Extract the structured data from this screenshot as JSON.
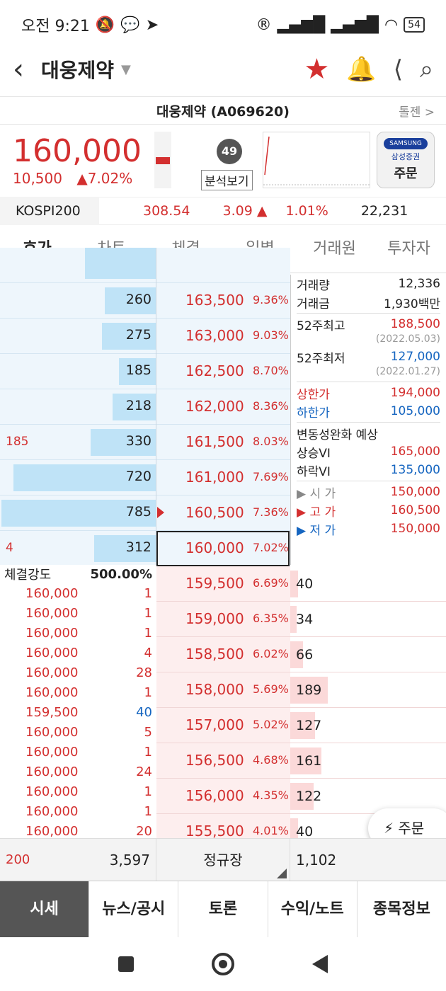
{
  "status": {
    "time": "오전 9:21",
    "battery": "54"
  },
  "header": {
    "title": "대웅제약"
  },
  "codebar": {
    "title": "대웅제약 (A069620)",
    "toggle": "톨젠 >"
  },
  "price": {
    "current": "160,000",
    "change": "10,500",
    "change_pct": "▲7.02%",
    "score": "49",
    "analysis": "분석보기"
  },
  "broker": {
    "logo": "SAMSUNG",
    "name": "삼성증권",
    "order": "주문"
  },
  "index": {
    "name": "KOSPI200",
    "value": "308.54",
    "change": "3.09 ▲",
    "pct": "1.01%",
    "volume": "22,231"
  },
  "tabs": [
    "호가",
    "차트",
    "체결",
    "일별",
    "거래원",
    "투자자"
  ],
  "asks": [
    {
      "qty": "260",
      "price": "163,500",
      "pct": "9.36%",
      "bar": 0.33,
      "left": ""
    },
    {
      "qty": "275",
      "price": "163,000",
      "pct": "9.03%",
      "bar": 0.35,
      "left": ""
    },
    {
      "qty": "185",
      "price": "162,500",
      "pct": "8.70%",
      "bar": 0.24,
      "left": ""
    },
    {
      "qty": "218",
      "price": "162,000",
      "pct": "8.36%",
      "bar": 0.28,
      "left": ""
    },
    {
      "qty": "330",
      "price": "161,500",
      "pct": "8.03%",
      "bar": 0.42,
      "left": "185"
    },
    {
      "qty": "720",
      "price": "161,000",
      "pct": "7.69%",
      "bar": 0.92,
      "left": ""
    },
    {
      "qty": "785",
      "price": "160,500",
      "pct": "7.36%",
      "bar": 1.0,
      "left": ""
    },
    {
      "qty": "312",
      "price": "160,000",
      "pct": "7.02%",
      "bar": 0.4,
      "left": "4"
    }
  ],
  "bids": [
    {
      "qty": "40",
      "price": "159,500",
      "pct": "6.69%",
      "bar": 0.05
    },
    {
      "qty": "34",
      "price": "159,000",
      "pct": "6.35%",
      "bar": 0.04
    },
    {
      "qty": "66",
      "price": "158,500",
      "pct": "6.02%",
      "bar": 0.08
    },
    {
      "qty": "189",
      "price": "158,000",
      "pct": "5.69%",
      "bar": 0.24
    },
    {
      "qty": "127",
      "price": "157,000",
      "pct": "5.02%",
      "bar": 0.16
    },
    {
      "qty": "161",
      "price": "156,500",
      "pct": "4.68%",
      "bar": 0.2
    },
    {
      "qty": "122",
      "price": "156,000",
      "pct": "4.35%",
      "bar": 0.15
    },
    {
      "qty": "40",
      "price": "155,500",
      "pct": "4.01%",
      "bar": 0.05
    }
  ],
  "info": {
    "vol_label": "거래량",
    "vol": "12,336",
    "amt_label": "거래금",
    "amt": "1,930백만",
    "hi52_label": "52주최고",
    "hi52": "188,500",
    "hi52_date": "(2022.05.03)",
    "lo52_label": "52주최저",
    "lo52": "127,000",
    "lo52_date": "(2022.01.27)",
    "upper_label": "상한가",
    "upper": "194,000",
    "lower_label": "하한가",
    "lower": "105,000",
    "vi_label": "변동성완화 예상",
    "vi_up_label": "상승VI",
    "vi_up": "165,000",
    "vi_down_label": "하락VI",
    "vi_down": "135,000",
    "open_label": "▶ 시 가",
    "open": "150,000",
    "high_label": "▶ 고 가",
    "high": "160,500",
    "low_label": "▶ 저 가",
    "low": "150,000"
  },
  "trades": {
    "strength_label": "체결강도",
    "strength": "500.00%",
    "rows": [
      {
        "p": "160,000",
        "q": "1"
      },
      {
        "p": "160,000",
        "q": "1"
      },
      {
        "p": "160,000",
        "q": "1"
      },
      {
        "p": "160,000",
        "q": "4"
      },
      {
        "p": "160,000",
        "q": "28"
      },
      {
        "p": "160,000",
        "q": "1"
      },
      {
        "p": "159,500",
        "q": "40"
      },
      {
        "p": "160,000",
        "q": "5"
      },
      {
        "p": "160,000",
        "q": "1"
      },
      {
        "p": "160,000",
        "q": "24"
      },
      {
        "p": "160,000",
        "q": "1"
      },
      {
        "p": "160,000",
        "q": "1"
      },
      {
        "p": "160,000",
        "q": "20"
      }
    ]
  },
  "fab": {
    "label": "⚡ 주문"
  },
  "summary": {
    "a": "200",
    "b": "3,597",
    "session": "정규장",
    "c": "1,102"
  },
  "bottom_tabs": [
    "시세",
    "뉴스/공시",
    "토론",
    "수익/노트",
    "종목정보"
  ]
}
